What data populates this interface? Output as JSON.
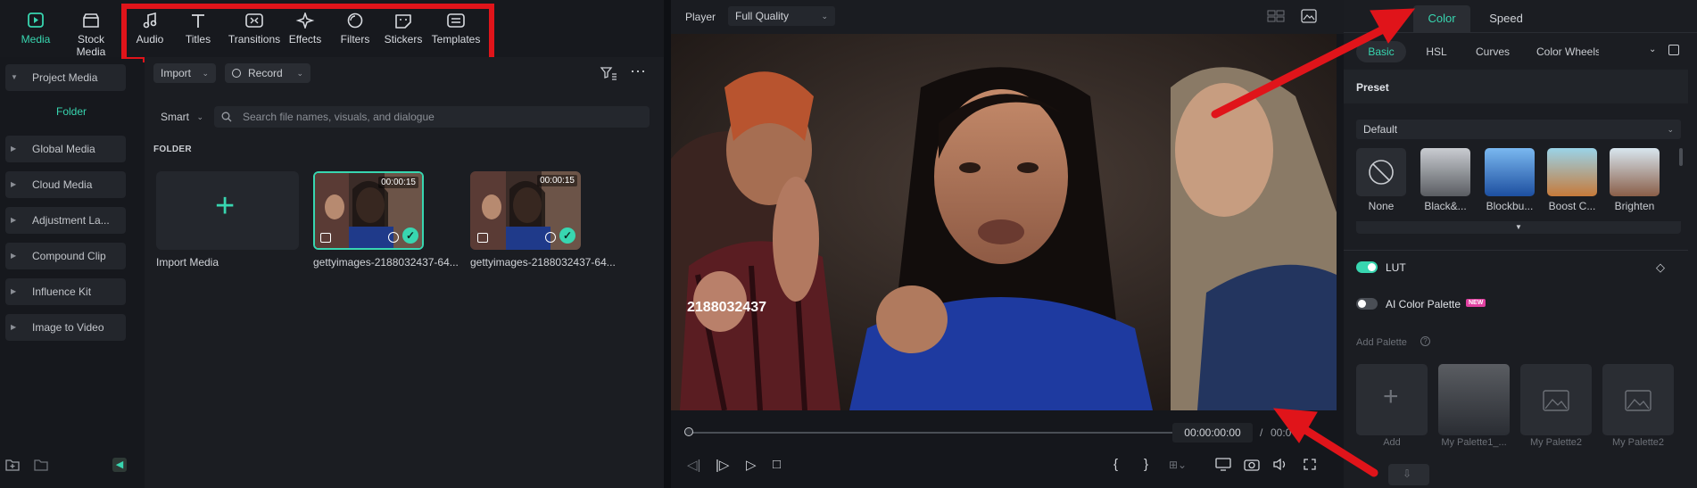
{
  "colors": {
    "accent": "#38d6b0",
    "highlight": "#e0141a",
    "panel": "#1b1d22"
  },
  "toolbar": {
    "media": {
      "label": "Media",
      "icon": "media-icon"
    },
    "stock_media": {
      "label": "Stock Media",
      "icon": "stock-media-icon"
    },
    "audio": {
      "label": "Audio",
      "icon": "music-note-icon"
    },
    "titles": {
      "label": "Titles",
      "icon": "text-t-icon"
    },
    "transitions": {
      "label": "Transitions",
      "icon": "transitions-icon"
    },
    "effects": {
      "label": "Effects",
      "icon": "sparkle-icon"
    },
    "filters": {
      "label": "Filters",
      "icon": "filter-icon"
    },
    "stickers": {
      "label": "Stickers",
      "icon": "sticker-icon"
    },
    "templates": {
      "label": "Templates",
      "icon": "templates-icon"
    }
  },
  "sidebar": {
    "items": [
      {
        "label": "Project Media"
      },
      {
        "label": "Folder"
      },
      {
        "label": "Global Media"
      },
      {
        "label": "Cloud Media"
      },
      {
        "label": "Adjustment La..."
      },
      {
        "label": "Compound Clip"
      },
      {
        "label": "Influence Kit"
      },
      {
        "label": "Image to Video"
      }
    ]
  },
  "media": {
    "import_label": "Import",
    "record_label": "Record",
    "smart_label": "Smart",
    "search_placeholder": "Search file names, visuals, and dialogue",
    "section_title": "FOLDER",
    "import_media_label": "Import Media",
    "clips": [
      {
        "name": "gettyimages-2188032437-64...",
        "duration": "00:00:15"
      },
      {
        "name": "gettyimages-2188032437-64...",
        "duration": "00:00:15"
      }
    ]
  },
  "player": {
    "label": "Player",
    "quality": "Full Quality",
    "overlay_text": "2188032437",
    "current_time": "00:00:00:00",
    "separator": "/",
    "total_time": "00:0"
  },
  "right_panel": {
    "tabs": [
      "Color",
      "Speed"
    ],
    "subtabs": [
      "Basic",
      "HSL",
      "Curves",
      "Color Wheels"
    ],
    "preset_title": "Preset",
    "preset_dropdown": "Default",
    "presets": [
      "None",
      "Black&...",
      "Blockbu...",
      "Boost C...",
      "Brighten"
    ],
    "lut_label": "LUT",
    "ai_palette_label": "AI Color Palette",
    "new_badge": "NEW",
    "add_palette_label": "Add Palette",
    "palettes": [
      "Add",
      "My Palette1_...",
      "My Palette2",
      "My Palette2"
    ]
  }
}
